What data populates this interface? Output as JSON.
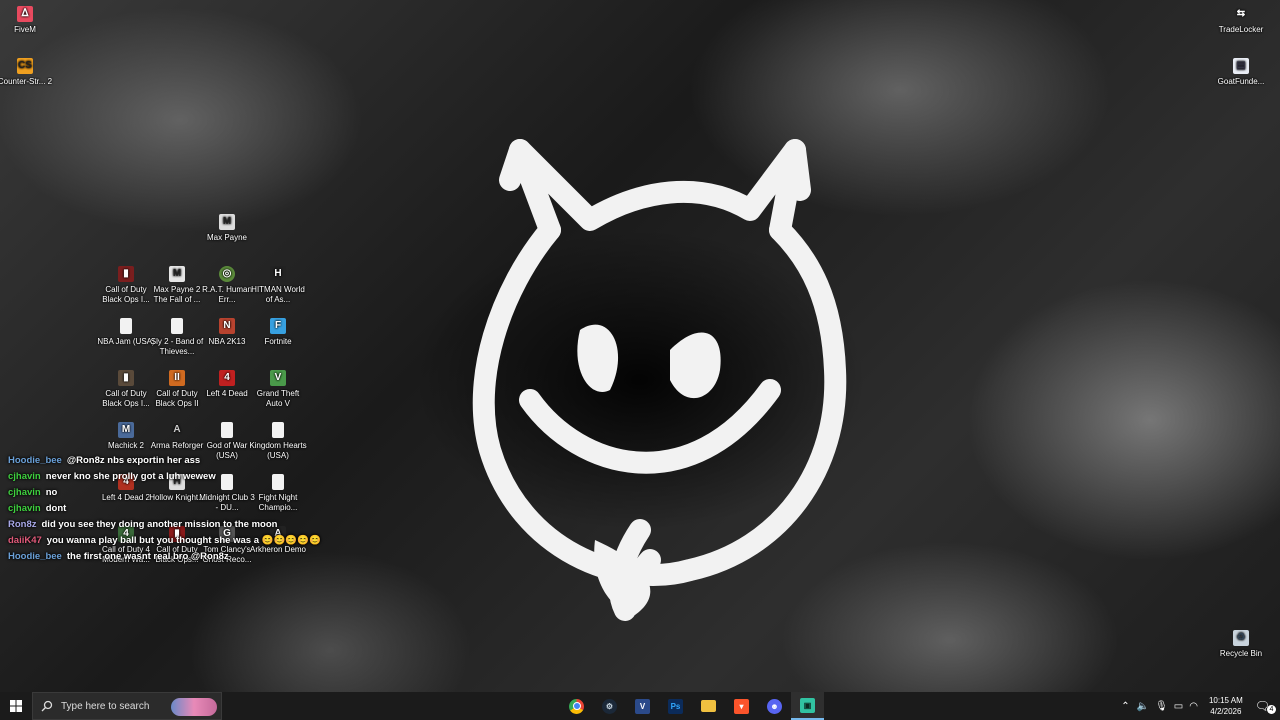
{
  "desktop": {
    "icons_left": [
      {
        "label": "FiveM",
        "icon": "fivem-icon",
        "color": "#e84a5f"
      },
      {
        "label": "Counter-Str... 2",
        "icon": "counter-strike-icon",
        "color": "#f0a020"
      }
    ],
    "icons_right": [
      {
        "label": "TradeLocker",
        "icon": "tradelocker-icon",
        "color": "#ffffff"
      },
      {
        "label": "GoatFunde...",
        "icon": "goatfunded-icon",
        "color": "#e9edf5"
      },
      {
        "label": "Recycle Bin",
        "icon": "recycle-bin-icon",
        "color": "#c8d3dc"
      }
    ],
    "icon_grid": [
      {
        "label": "Max Payne",
        "icon": "max-payne-icon",
        "color": "#dddddd"
      },
      {
        "label": "Call of Duty Black Ops I...",
        "icon": "cod-black-ops-icon",
        "color": "#7a1e1e"
      },
      {
        "label": "Max Payne 2 The Fall of ...",
        "icon": "max-payne-2-icon",
        "color": "#e6e6e6"
      },
      {
        "label": "R.A.T. Human Err...",
        "icon": "rat-icon",
        "color": "#5a8a3a"
      },
      {
        "label": "HITMAN World of As...",
        "icon": "hitman-icon",
        "color": "#222222"
      },
      {
        "label": "NBA Jam (USA)",
        "icon": "file-icon",
        "color": "#f2f2f2"
      },
      {
        "label": "Sly 2 - Band of Thieves...",
        "icon": "file-icon",
        "color": "#f2f2f2"
      },
      {
        "label": "NBA 2K13",
        "icon": "nba2k13-icon",
        "color": "#b8432f"
      },
      {
        "label": "Fortnite",
        "icon": "fortnite-icon",
        "color": "#37a0e0"
      },
      {
        "label": "Call of Duty Black Ops I...",
        "icon": "cod-black-ops-icon",
        "color": "#5a4a3a"
      },
      {
        "label": "Call of Duty Black Ops II",
        "icon": "cod-black-ops-2-icon",
        "color": "#d06a20"
      },
      {
        "label": "Left 4 Dead",
        "icon": "left4dead-icon",
        "color": "#c02020"
      },
      {
        "label": "Grand Theft Auto V",
        "icon": "gta5-icon",
        "color": "#4a9a4a"
      },
      {
        "label": "Machick 2",
        "icon": "machick-icon",
        "color": "#4a6a9a"
      },
      {
        "label": "Arma Reforger",
        "icon": "arma-icon",
        "color": "#cccccc"
      },
      {
        "label": "God of War (USA)",
        "icon": "file-icon",
        "color": "#f2f2f2"
      },
      {
        "label": "Kingdom Hearts (USA)",
        "icon": "file-icon",
        "color": "#f2f2f2"
      },
      {
        "label": "Left 4 Dead 2",
        "icon": "left4dead2-icon",
        "color": "#b03020"
      },
      {
        "label": "Hollow Knight...",
        "icon": "hollow-knight-icon",
        "color": "#dddddd"
      },
      {
        "label": "Midnight Club 3 - DU...",
        "icon": "file-icon",
        "color": "#f2f2f2"
      },
      {
        "label": "Fight Night Champio...",
        "icon": "file-icon",
        "color": "#f2f2f2"
      },
      {
        "label": "Call of Duty 4 Modern Wa...",
        "icon": "cod4-icon",
        "color": "#3a6a3a"
      },
      {
        "label": "Call of Duty Black Ops...",
        "icon": "cod-black-ops-icon",
        "color": "#8a1a1a"
      },
      {
        "label": "Tom Clancy's Ghost Reco...",
        "icon": "ghost-recon-icon",
        "color": "#555555"
      },
      {
        "label": "Arkheron Demo",
        "icon": "arkheron-icon",
        "color": "#222222"
      }
    ],
    "chat": [
      {
        "user": "Hoodie_bee",
        "color": "#6aa0d8",
        "message": "@Ron8z nbs exportin her ass"
      },
      {
        "user": "cjhavin",
        "color": "#3fd13f",
        "message": "never kno she prolly got a luh wewew"
      },
      {
        "user": "cjhavin",
        "color": "#3fd13f",
        "message": "no"
      },
      {
        "user": "cjhavin",
        "color": "#3fd13f",
        "message": "dont"
      },
      {
        "user": "Ron8z",
        "color": "#a8a8e8",
        "message": "did you see they doing another mission to the moon"
      },
      {
        "user": "daiiK47",
        "color": "#e05a7a",
        "message": "you wanna play ball but you thought she was a"
      },
      {
        "user": "Hoodie_bee",
        "color": "#6aa0d8",
        "message": "the first one wasnt real bro @Ron8z"
      }
    ]
  },
  "taskbar": {
    "search_placeholder": "Type here to search",
    "apps": [
      {
        "name": "chrome-icon",
        "color": "#4285f4",
        "active": false
      },
      {
        "name": "steam-icon",
        "color": "#1b2838",
        "active": false
      },
      {
        "name": "visual-studio-icon",
        "color": "#2b4a8a",
        "letter": "V",
        "active": false
      },
      {
        "name": "photoshop-icon",
        "color": "#0b2b5a",
        "letter": "Ps",
        "active": false
      },
      {
        "name": "file-explorer-icon",
        "color": "#f0c040",
        "active": false
      },
      {
        "name": "brave-icon",
        "color": "#fb542b",
        "active": false
      },
      {
        "name": "discord-icon",
        "color": "#5865f2",
        "active": false
      },
      {
        "name": "streamlabs-icon",
        "color": "#31c3a2",
        "active": true
      }
    ],
    "time": "10:15 AM",
    "date": "4/2/2026",
    "notification_count": "4"
  }
}
